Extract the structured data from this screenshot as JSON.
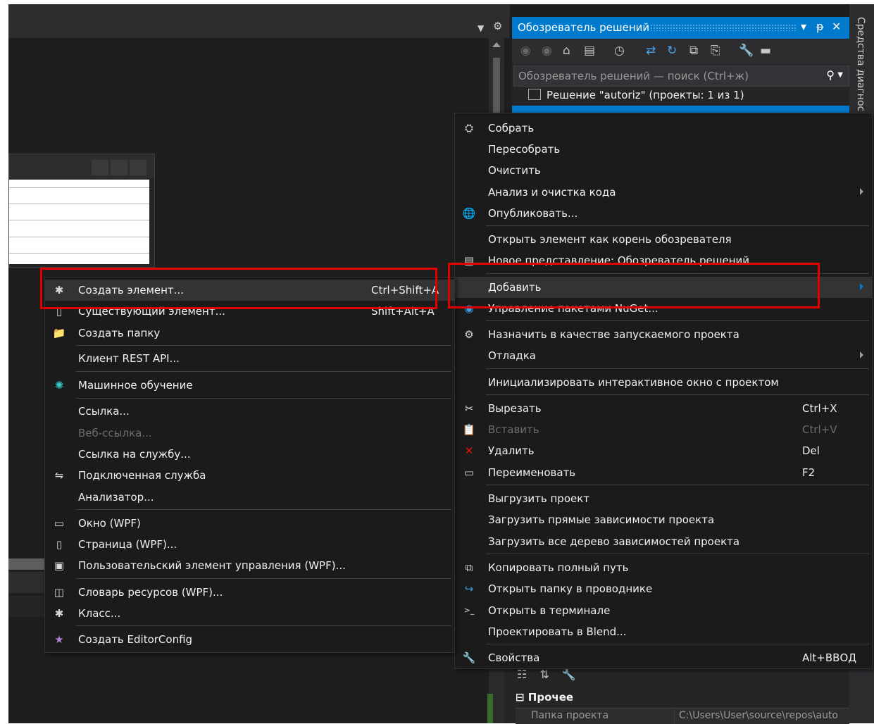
{
  "solution_explorer": {
    "title": "Обозреватель решений",
    "controls": [
      "▾",
      "ᵽ",
      "✕"
    ],
    "side_tab": "Средства диагнос",
    "search_placeholder": "Обозреватель решений — поиск (Ctrl+ж)",
    "solution_label": "Решение \"autoriz\" (проекты: 1 из 1)"
  },
  "properties": {
    "category": "Прочее",
    "row_key": "Папка проекта",
    "row_value": "C:\\Users\\User\\source\\repos\\auto"
  },
  "context_menu_project": {
    "items": [
      {
        "icon": "build-icon",
        "glyph": "⛭",
        "label": "Собрать",
        "shortcut": "",
        "submenu": false,
        "disabled": false
      },
      {
        "icon": "",
        "glyph": "",
        "label": "Пересобрать",
        "shortcut": "",
        "submenu": false,
        "disabled": false
      },
      {
        "icon": "",
        "glyph": "",
        "label": "Очистить",
        "shortcut": "",
        "submenu": false,
        "disabled": false
      },
      {
        "icon": "",
        "glyph": "",
        "label": "Анализ и очистка кода",
        "shortcut": "",
        "submenu": true,
        "disabled": false
      },
      {
        "icon": "publish-globe-icon",
        "glyph": "🌐",
        "label": "Опубликовать...",
        "shortcut": "",
        "submenu": false,
        "disabled": false
      },
      {
        "icon": "",
        "glyph": "",
        "label": "Открыть элемент как корень обозревателя",
        "shortcut": "",
        "submenu": false,
        "disabled": false
      },
      {
        "icon": "new-view-icon",
        "glyph": "▤",
        "label": "Новое представление: Обозреватель решений",
        "shortcut": "",
        "submenu": false,
        "disabled": false
      },
      {
        "icon": "",
        "glyph": "",
        "label": "Добавить",
        "shortcut": "",
        "submenu": true,
        "disabled": false
      },
      {
        "icon": "nuget-icon",
        "glyph": "◉",
        "label": "Управление пакетами NuGet...",
        "shortcut": "",
        "submenu": false,
        "disabled": false
      },
      {
        "icon": "gear-icon",
        "glyph": "⚙",
        "label": "Назначить в качестве запускаемого проекта",
        "shortcut": "",
        "submenu": false,
        "disabled": false
      },
      {
        "icon": "",
        "glyph": "",
        "label": "Отладка",
        "shortcut": "",
        "submenu": true,
        "disabled": false
      },
      {
        "icon": "",
        "glyph": "",
        "label": "Инициализировать интерактивное окно с проектом",
        "shortcut": "",
        "submenu": false,
        "disabled": false
      },
      {
        "icon": "scissors-icon",
        "glyph": "✂",
        "label": "Вырезать",
        "shortcut": "Ctrl+X",
        "submenu": false,
        "disabled": false
      },
      {
        "icon": "paste-icon",
        "glyph": "📋",
        "label": "Вставить",
        "shortcut": "Ctrl+V",
        "submenu": false,
        "disabled": true
      },
      {
        "icon": "delete-x-icon",
        "glyph": "✕",
        "label": "Удалить",
        "shortcut": "Del",
        "submenu": false,
        "disabled": false
      },
      {
        "icon": "rename-icon",
        "glyph": "▭",
        "label": "Переименовать",
        "shortcut": "F2",
        "submenu": false,
        "disabled": false
      },
      {
        "icon": "",
        "glyph": "",
        "label": "Выгрузить проект",
        "shortcut": "",
        "submenu": false,
        "disabled": false
      },
      {
        "icon": "",
        "glyph": "",
        "label": "Загрузить прямые зависимости проекта",
        "shortcut": "",
        "submenu": false,
        "disabled": false
      },
      {
        "icon": "",
        "glyph": "",
        "label": "Загрузить все дерево зависимостей проекта",
        "shortcut": "",
        "submenu": false,
        "disabled": false
      },
      {
        "icon": "copy-path-icon",
        "glyph": "⧉",
        "label": "Копировать полный путь",
        "shortcut": "",
        "submenu": false,
        "disabled": false
      },
      {
        "icon": "open-folder-arrow-icon",
        "glyph": "↪",
        "label": "Открыть папку в проводнике",
        "shortcut": "",
        "submenu": false,
        "disabled": false
      },
      {
        "icon": "terminal-icon",
        "glyph": ">_",
        "label": "Открыть в терминале",
        "shortcut": "",
        "submenu": false,
        "disabled": false
      },
      {
        "icon": "",
        "glyph": "",
        "label": "Проектировать в Blend...",
        "shortcut": "",
        "submenu": false,
        "disabled": false
      },
      {
        "icon": "wrench-icon",
        "glyph": "🔧",
        "label": "Свойства",
        "shortcut": "Alt+ВВОД",
        "submenu": false,
        "disabled": false
      }
    ]
  },
  "context_menu_add": {
    "items": [
      {
        "icon": "new-item-icon",
        "glyph": "✱",
        "label": "Создать элемент...",
        "shortcut": "Ctrl+Shift+A",
        "disabled": false
      },
      {
        "icon": "existing-item-icon",
        "glyph": "▯",
        "label": "Существующий элемент...",
        "shortcut": "Shift+Alt+A",
        "disabled": false
      },
      {
        "icon": "new-folder-icon",
        "glyph": "📁",
        "label": "Создать папку",
        "shortcut": "",
        "disabled": false
      },
      {
        "icon": "",
        "glyph": "",
        "label": "Клиент REST API...",
        "shortcut": "",
        "disabled": false
      },
      {
        "icon": "ml-icon",
        "glyph": "✺",
        "label": "Машинное обучение",
        "shortcut": "",
        "disabled": false
      },
      {
        "icon": "",
        "glyph": "",
        "label": "Ссылка...",
        "shortcut": "",
        "disabled": false
      },
      {
        "icon": "",
        "glyph": "",
        "label": "Веб-ссылка...",
        "shortcut": "",
        "disabled": true
      },
      {
        "icon": "",
        "glyph": "",
        "label": "Ссылка на службу...",
        "shortcut": "",
        "disabled": false
      },
      {
        "icon": "connected-service-icon",
        "glyph": "⇋",
        "label": "Подключенная служба",
        "shortcut": "",
        "disabled": false
      },
      {
        "icon": "",
        "glyph": "",
        "label": "Анализатор...",
        "shortcut": "",
        "disabled": false
      },
      {
        "icon": "wpf-window-icon",
        "glyph": "▭",
        "label": "Окно (WPF)",
        "shortcut": "",
        "disabled": false
      },
      {
        "icon": "wpf-page-icon",
        "glyph": "▯",
        "label": "Страница (WPF)...",
        "shortcut": "",
        "disabled": false
      },
      {
        "icon": "user-control-icon",
        "glyph": "▣",
        "label": "Пользовательский элемент управления (WPF)...",
        "shortcut": "",
        "disabled": false
      },
      {
        "icon": "resource-dictionary-icon",
        "glyph": "◫",
        "label": "Словарь ресурсов (WPF)...",
        "shortcut": "",
        "disabled": false
      },
      {
        "icon": "class-icon",
        "glyph": "✱",
        "label": "Класс...",
        "shortcut": "",
        "disabled": false
      },
      {
        "icon": "editorconfig-icon",
        "glyph": "★",
        "label": "Создать EditorConfig",
        "shortcut": "",
        "disabled": false
      }
    ]
  },
  "colors": {
    "accent": "#007acc",
    "highlight_box": "#e00000",
    "delete_icon": "#e51400",
    "globe_icon": "#3c9fe8",
    "ml_icon": "#37c9c9",
    "folder_icon": "#dcb67a",
    "editorconfig_icon": "#b180d7"
  }
}
